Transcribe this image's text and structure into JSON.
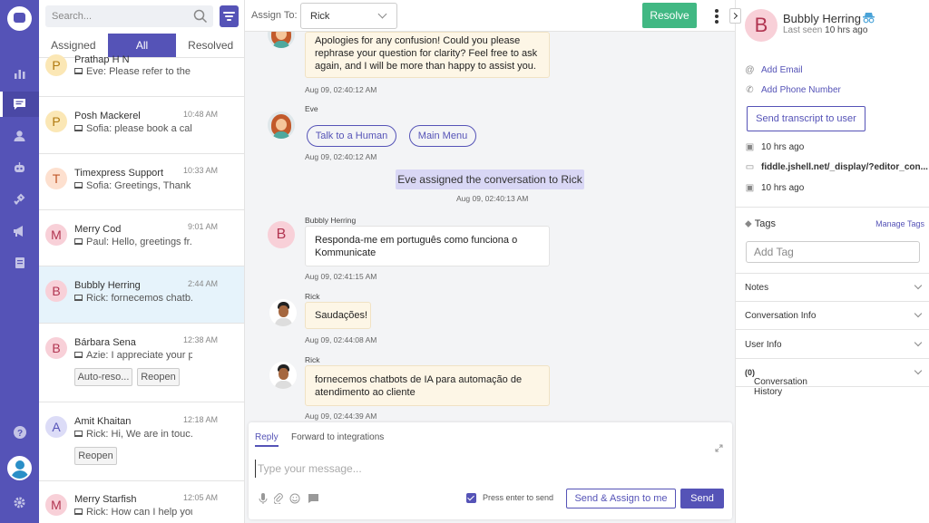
{
  "nav": {
    "items": [
      "reports-icon",
      "conversations-icon",
      "users-icon",
      "bot-icon",
      "integrations-icon",
      "campaigns-icon",
      "knowledge-base-icon"
    ],
    "bottom": [
      "help-icon",
      "profile-avatar",
      "settings-icon"
    ]
  },
  "search": {
    "placeholder": "Search..."
  },
  "tabs": [
    "Assigned",
    "All",
    "Resolved"
  ],
  "conversations": [
    {
      "initial": "P",
      "name": "Prathap H N",
      "time": "",
      "preview": "Eve: Please refer to the ...",
      "color": "#fbe7b5",
      "textcolor": "#b07a10"
    },
    {
      "initial": "P",
      "name": "Posh Mackerel",
      "time": "10:48 AM",
      "preview": "Sofia: please book a cal...",
      "color": "#fbe7b5",
      "textcolor": "#b07a10"
    },
    {
      "initial": "T",
      "name": "Timexpress Support",
      "time": "10:33 AM",
      "preview": "Sofia: Greetings, Thank ...",
      "color": "#fde0cf",
      "textcolor": "#c1582a"
    },
    {
      "initial": "M",
      "name": "Merry Cod",
      "time": "9:01 AM",
      "preview": "Paul: Hello, greetings fr...",
      "color": "#f8d0d8",
      "textcolor": "#b13551"
    },
    {
      "initial": "B",
      "name": "Bubbly Herring",
      "time": "2:44 AM",
      "preview": "Rick: fornecemos chatb...",
      "color": "#f8d0d8",
      "textcolor": "#b13551"
    },
    {
      "initial": "B",
      "name": "Bárbara Sena",
      "time": "12:38 AM",
      "preview": "Azie: I appreciate your p...",
      "color": "#f8d0d8",
      "textcolor": "#b13551",
      "chips": [
        "Auto-reso...",
        "Reopen"
      ]
    },
    {
      "initial": "A",
      "name": "Amit Khaitan",
      "time": "12:18 AM",
      "preview": "Rick: Hi,  We are in touc...",
      "color": "#dcdcf7",
      "textcolor": "#5553b7",
      "chips": [
        "Reopen"
      ]
    },
    {
      "initial": "M",
      "name": "Merry Starfish",
      "time": "12:05 AM",
      "preview": "Rick: How can I help you?",
      "color": "#f8d0d8",
      "textcolor": "#b13551"
    }
  ],
  "header": {
    "assign_label": "Assign To:",
    "assignee": "Rick",
    "resolve_label": "Resolve"
  },
  "chat": {
    "msg1": {
      "text": "Apologies for any confusion! Could you please rephrase your question for clarity? Feel free to ask again, and I will be more than happy to assist you.",
      "time": "Aug 09, 02:40:12 AM"
    },
    "msg2": {
      "sender": "Eve",
      "buttons": [
        "Talk to a Human",
        "Main Menu"
      ],
      "time": "Aug 09, 02:40:12 AM"
    },
    "event": {
      "text": "Eve assigned the conversation to Rick",
      "time": "Aug 09, 02:40:13 AM"
    },
    "msg3": {
      "sender": "Bubbly Herring",
      "initial": "B",
      "text": "Responda-me em português como funciona o Kommunicate",
      "time": "Aug 09, 02:41:15 AM"
    },
    "msg4": {
      "sender": "Rick",
      "text": "Saudações!",
      "time": "Aug 09, 02:44:08 AM"
    },
    "msg5": {
      "sender": "Rick",
      "text": "fornecemos chatbots de IA para automação de atendimento ao cliente",
      "time": "Aug 09, 02:44:39 AM"
    }
  },
  "composer": {
    "tab_reply": "Reply",
    "tab_forward": "Forward to integrations",
    "placeholder": "Type your message...",
    "enter_label": "Press enter to send",
    "enter_checked": true,
    "send_assign_label": "Send & Assign to me",
    "send_label": "Send"
  },
  "profile": {
    "initial": "B",
    "name": "Bubbly Herring",
    "last_seen_prefix": "Last seen",
    "last_seen_value": "10 hrs ago",
    "add_email": "Add Email",
    "add_phone": "Add Phone Number",
    "transcript_label": "Send transcript to user",
    "first_seen": "10 hrs ago",
    "url": "fiddle.jshell.net/_display/?editor_con...",
    "last_message": "10 hrs ago",
    "tags_title": "Tags",
    "manage_tags": "Manage Tags",
    "tag_placeholder": "Add Tag",
    "sections": [
      "Notes",
      "Conversation Info",
      "User Info",
      "Conversation History"
    ],
    "history_count": "(0)"
  },
  "colors": {
    "brand": "#5553b7",
    "resolve": "#41b883",
    "selected_row": "#e6f3fb",
    "bot_bubble": "#fdf6e6",
    "event_bg": "#d9d7f5"
  }
}
